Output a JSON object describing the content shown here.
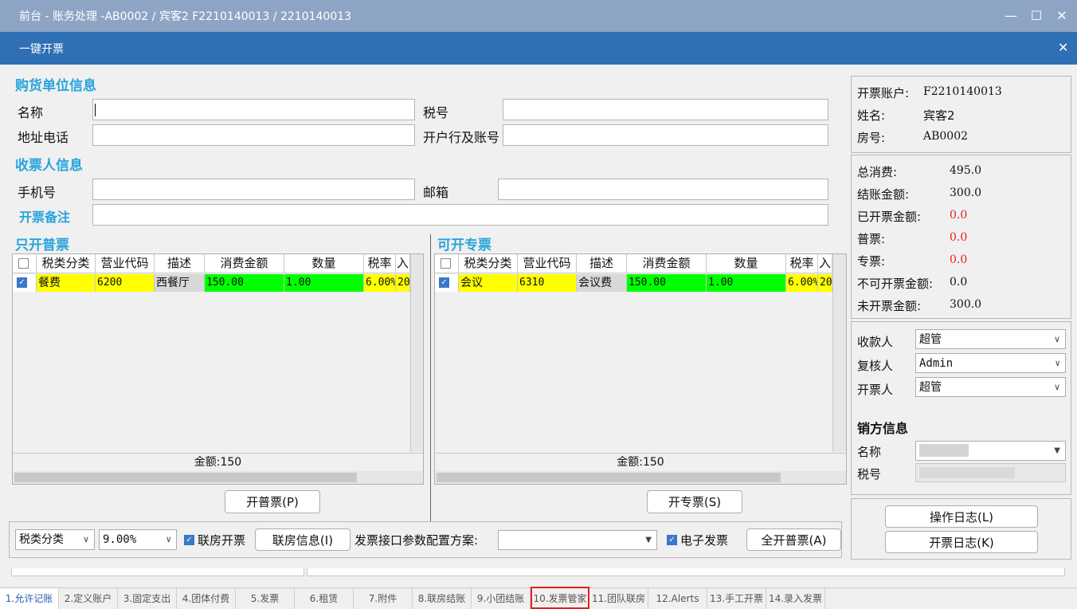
{
  "window": {
    "title": "前台 - 账务处理 -AB0002 / 宾客2 F2210140013 / 2210140013",
    "min": "—",
    "max": "☐",
    "close": "✕"
  },
  "dialog": {
    "title": "一键开票",
    "close": "✕"
  },
  "buyer": {
    "section": "购货单位信息",
    "name_label": "名称",
    "taxno_label": "税号",
    "addr_label": "地址电话",
    "bank_label": "开户行及账号"
  },
  "receiver": {
    "section": "收票人信息",
    "phone_label": "手机号",
    "email_label": "邮箱",
    "remark_label": "开票备注"
  },
  "left_grid": {
    "section": "只开普票",
    "headers": [
      "税类分类",
      "营业代码",
      "描述",
      "消费金额",
      "数量",
      "税率",
      "入"
    ],
    "row": [
      "餐费",
      "6200",
      "西餐厅",
      "150.00",
      "1.00",
      "6.00%",
      "20"
    ],
    "total": "金额:150",
    "button": "开普票(P)"
  },
  "right_grid": {
    "section": "可开专票",
    "headers": [
      "税类分类",
      "营业代码",
      "描述",
      "消费金额",
      "数量",
      "税率",
      "入"
    ],
    "row": [
      "会议",
      "6310",
      "会议费",
      "150.00",
      "1.00",
      "6.00%",
      "20"
    ],
    "total": "金额:150",
    "button": "开专票(S)"
  },
  "bottom": {
    "tax_category": "税类分类",
    "tax_rate": "9.00%",
    "joint_room_checkbox": "联房开票",
    "joint_room_info": "联房信息(I)",
    "scheme_label": "发票接口参数配置方案:",
    "scheme_value": "",
    "einvoice_checkbox": "电子发票",
    "all_normal": "全开普票(A)"
  },
  "account": {
    "account_label": "开票账户:",
    "account_value": "F2210140013",
    "name_label": "姓名:",
    "name_value": "宾客2",
    "room_label": "房号:",
    "room_value": "AB0002"
  },
  "summary": [
    {
      "label": "总消费:",
      "value": "495.0",
      "color": "#111111"
    },
    {
      "label": "结账金额:",
      "value": "300.0",
      "color": "#111111"
    },
    {
      "label": "已开票金额:",
      "value": "0.0",
      "color": "#e02020"
    },
    {
      "label": "普票:",
      "value": "0.0",
      "color": "#e02020"
    },
    {
      "label": "专票:",
      "value": "0.0",
      "color": "#e02020"
    },
    {
      "label": "不可开票金额:",
      "value": "0.0",
      "color": "#111111"
    },
    {
      "label": "未开票金额:",
      "value": "300.0",
      "color": "#111111"
    }
  ],
  "people": {
    "payee_label": "收款人",
    "payee": "超管",
    "reviewer_label": "复核人",
    "reviewer": "Admin",
    "drawer_label": "开票人",
    "drawer": "超管"
  },
  "seller": {
    "section": "销方信息",
    "name_label": "名称",
    "taxno_label": "税号"
  },
  "logs": {
    "op_log": "操作日志(L)",
    "invoice_log": "开票日志(K)"
  },
  "tabs": [
    "1.允许记账",
    "2.定义账户",
    "3.固定支出",
    "4.团体付费",
    "5.发票",
    "6.租赁",
    "7.附件",
    "8.联房结账",
    "9.小团结账",
    "10.发票管家",
    "11.团队联房",
    "12.Alerts",
    "13.手工开票",
    "14.录入发票"
  ],
  "active_tab": "1.允许记账",
  "highlighted_tab": "10.发票管家"
}
